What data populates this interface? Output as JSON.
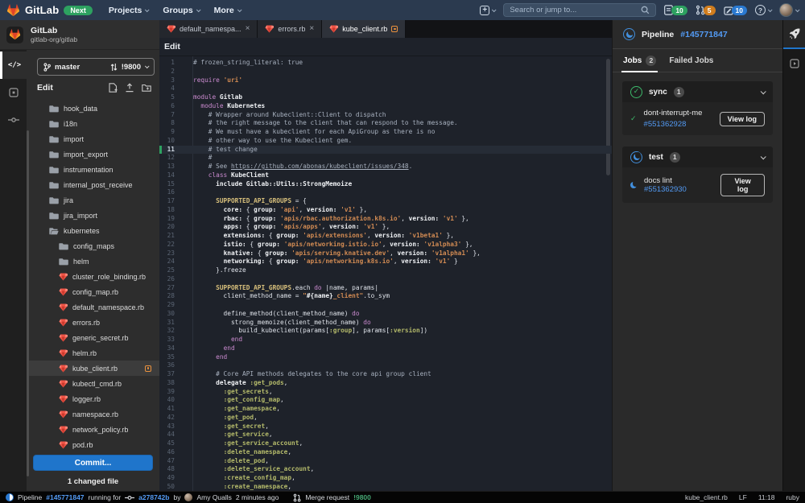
{
  "topbar": {
    "product_name": "GitLab",
    "next_badge": "Next",
    "nav": [
      {
        "label": "Projects"
      },
      {
        "label": "Groups"
      },
      {
        "label": "More"
      }
    ],
    "search_placeholder": "Search or jump to...",
    "issues_count": "10",
    "merge_requests_count": "5",
    "todos_count": "10"
  },
  "project": {
    "name": "GitLab",
    "path": "gitlab-org/gitlab"
  },
  "sidebar": {
    "branch": "master",
    "merge_request_ref": "!9800",
    "panel_title": "Edit",
    "tree": [
      {
        "type": "folder",
        "name": "hook_data",
        "indent": 0
      },
      {
        "type": "folder",
        "name": "i18n",
        "indent": 0
      },
      {
        "type": "folder",
        "name": "import",
        "indent": 0
      },
      {
        "type": "folder",
        "name": "import_export",
        "indent": 0
      },
      {
        "type": "folder",
        "name": "instrumentation",
        "indent": 0
      },
      {
        "type": "folder",
        "name": "internal_post_receive",
        "indent": 0
      },
      {
        "type": "folder",
        "name": "jira",
        "indent": 0
      },
      {
        "type": "folder",
        "name": "jira_import",
        "indent": 0
      },
      {
        "type": "folder-open",
        "name": "kubernetes",
        "indent": 0
      },
      {
        "type": "folder",
        "name": "config_maps",
        "indent": 1
      },
      {
        "type": "folder",
        "name": "helm",
        "indent": 1
      },
      {
        "type": "file",
        "name": "cluster_role_binding.rb",
        "indent": 1
      },
      {
        "type": "file",
        "name": "config_map.rb",
        "indent": 1
      },
      {
        "type": "file",
        "name": "default_namespace.rb",
        "indent": 1
      },
      {
        "type": "file",
        "name": "errors.rb",
        "indent": 1
      },
      {
        "type": "file",
        "name": "generic_secret.rb",
        "indent": 1
      },
      {
        "type": "file",
        "name": "helm.rb",
        "indent": 1
      },
      {
        "type": "file",
        "name": "kube_client.rb",
        "indent": 1,
        "selected": true,
        "modified": true
      },
      {
        "type": "file",
        "name": "kubectl_cmd.rb",
        "indent": 1
      },
      {
        "type": "file",
        "name": "logger.rb",
        "indent": 1
      },
      {
        "type": "file",
        "name": "namespace.rb",
        "indent": 1
      },
      {
        "type": "file",
        "name": "network_policy.rb",
        "indent": 1
      },
      {
        "type": "file",
        "name": "pod.rb",
        "indent": 1
      }
    ],
    "commit_button": "Commit...",
    "changed_files": "1 changed file"
  },
  "editor": {
    "mode_label": "Edit",
    "tabs": [
      {
        "label": "default_namespa...",
        "closable": true
      },
      {
        "label": "errors.rb",
        "closable": true
      },
      {
        "label": "kube_client.rb",
        "active": true,
        "modified": true
      }
    ],
    "current_line": 11,
    "lines": [
      [
        [
          "c",
          "# frozen_string_literal: true"
        ]
      ],
      [],
      [
        [
          "k",
          "require"
        ],
        [
          "p",
          " "
        ],
        [
          "s",
          "'uri'"
        ]
      ],
      [],
      [
        [
          "k",
          "module"
        ],
        [
          "p",
          " "
        ],
        [
          "b",
          "Gitlab"
        ]
      ],
      [
        [
          "p",
          "  "
        ],
        [
          "k",
          "module"
        ],
        [
          "p",
          " "
        ],
        [
          "b",
          "Kubernetes"
        ]
      ],
      [
        [
          "p",
          "    "
        ],
        [
          "c",
          "# Wrapper around Kubeclient::Client to dispatch"
        ]
      ],
      [
        [
          "p",
          "    "
        ],
        [
          "c",
          "# the right message to the client that can respond to the message."
        ]
      ],
      [
        [
          "p",
          "    "
        ],
        [
          "c",
          "# We must have a kubeclient for each ApiGroup as there is no"
        ]
      ],
      [
        [
          "p",
          "    "
        ],
        [
          "c",
          "# other way to use the Kubeclient gem."
        ]
      ],
      [
        [
          "p",
          "    "
        ],
        [
          "c",
          "# test change"
        ]
      ],
      [
        [
          "p",
          "    "
        ],
        [
          "c",
          "#"
        ]
      ],
      [
        [
          "p",
          "    "
        ],
        [
          "c",
          "# See "
        ],
        [
          "u",
          "https://github.com/abonas/kubeclient/issues/348"
        ],
        [
          "c",
          "."
        ]
      ],
      [
        [
          "p",
          "    "
        ],
        [
          "k",
          "class"
        ],
        [
          "p",
          " "
        ],
        [
          "b",
          "KubeClient"
        ]
      ],
      [
        [
          "p",
          "      "
        ],
        [
          "b",
          "include Gitlab::Utils::StrongMemoize"
        ]
      ],
      [],
      [
        [
          "p",
          "      "
        ],
        [
          "y",
          "SUPPORTED_API_GROUPS"
        ],
        [
          "p",
          " = {"
        ]
      ],
      [
        [
          "p",
          "        "
        ],
        [
          "b",
          "core:"
        ],
        [
          "p",
          " { "
        ],
        [
          "b",
          "group:"
        ],
        [
          "p",
          " "
        ],
        [
          "s",
          "'api'"
        ],
        [
          "p",
          ", "
        ],
        [
          "b",
          "version:"
        ],
        [
          "p",
          " "
        ],
        [
          "s",
          "'v1'"
        ],
        [
          "p",
          " },"
        ]
      ],
      [
        [
          "p",
          "        "
        ],
        [
          "b",
          "rbac:"
        ],
        [
          "p",
          " { "
        ],
        [
          "b",
          "group:"
        ],
        [
          "p",
          " "
        ],
        [
          "s",
          "'apis/rbac.authorization.k8s.io'"
        ],
        [
          "p",
          ", "
        ],
        [
          "b",
          "version:"
        ],
        [
          "p",
          " "
        ],
        [
          "s",
          "'v1'"
        ],
        [
          "p",
          " },"
        ]
      ],
      [
        [
          "p",
          "        "
        ],
        [
          "b",
          "apps:"
        ],
        [
          "p",
          " { "
        ],
        [
          "b",
          "group:"
        ],
        [
          "p",
          " "
        ],
        [
          "s",
          "'apis/apps'"
        ],
        [
          "p",
          ", "
        ],
        [
          "b",
          "version:"
        ],
        [
          "p",
          " "
        ],
        [
          "s",
          "'v1'"
        ],
        [
          "p",
          " },"
        ]
      ],
      [
        [
          "p",
          "        "
        ],
        [
          "b",
          "extensions:"
        ],
        [
          "p",
          " { "
        ],
        [
          "b",
          "group:"
        ],
        [
          "p",
          " "
        ],
        [
          "s",
          "'apis/extensions'"
        ],
        [
          "p",
          ", "
        ],
        [
          "b",
          "version:"
        ],
        [
          "p",
          " "
        ],
        [
          "s",
          "'v1beta1'"
        ],
        [
          "p",
          " },"
        ]
      ],
      [
        [
          "p",
          "        "
        ],
        [
          "b",
          "istio:"
        ],
        [
          "p",
          " { "
        ],
        [
          "b",
          "group:"
        ],
        [
          "p",
          " "
        ],
        [
          "s",
          "'apis/networking.istio.io'"
        ],
        [
          "p",
          ", "
        ],
        [
          "b",
          "version:"
        ],
        [
          "p",
          " "
        ],
        [
          "s",
          "'v1alpha3'"
        ],
        [
          "p",
          " },"
        ]
      ],
      [
        [
          "p",
          "        "
        ],
        [
          "b",
          "knative:"
        ],
        [
          "p",
          " { "
        ],
        [
          "b",
          "group:"
        ],
        [
          "p",
          " "
        ],
        [
          "s",
          "'apis/serving.knative.dev'"
        ],
        [
          "p",
          ", "
        ],
        [
          "b",
          "version:"
        ],
        [
          "p",
          " "
        ],
        [
          "s",
          "'v1alpha1'"
        ],
        [
          "p",
          " },"
        ]
      ],
      [
        [
          "p",
          "        "
        ],
        [
          "b",
          "networking:"
        ],
        [
          "p",
          " { "
        ],
        [
          "b",
          "group:"
        ],
        [
          "p",
          " "
        ],
        [
          "s",
          "'apis/networking.k8s.io'"
        ],
        [
          "p",
          ", "
        ],
        [
          "b",
          "version:"
        ],
        [
          "p",
          " "
        ],
        [
          "s",
          "'v1'"
        ],
        [
          "p",
          " }"
        ]
      ],
      [
        [
          "p",
          "      }.freeze"
        ]
      ],
      [],
      [
        [
          "p",
          "      "
        ],
        [
          "y",
          "SUPPORTED_API_GROUPS"
        ],
        [
          "p",
          ".each "
        ],
        [
          "k",
          "do"
        ],
        [
          "p",
          " |name, params|"
        ]
      ],
      [
        [
          "p",
          "        client_method_name = "
        ],
        [
          "s",
          "\""
        ],
        [
          "b",
          "#{name}"
        ],
        [
          "s",
          "_client\""
        ],
        [
          "p",
          ".to_sym"
        ]
      ],
      [],
      [
        [
          "p",
          "        define_method(client_method_name) "
        ],
        [
          "k",
          "do"
        ]
      ],
      [
        [
          "p",
          "          strong_memoize(client_method_name) "
        ],
        [
          "k",
          "do"
        ]
      ],
      [
        [
          "p",
          "            build_kubeclient(params["
        ],
        [
          "m",
          ":group"
        ],
        [
          "p",
          "], params["
        ],
        [
          "m",
          ":version"
        ],
        [
          "p",
          "])"
        ]
      ],
      [
        [
          "p",
          "          "
        ],
        [
          "k",
          "end"
        ]
      ],
      [
        [
          "p",
          "        "
        ],
        [
          "k",
          "end"
        ]
      ],
      [
        [
          "p",
          "      "
        ],
        [
          "k",
          "end"
        ]
      ],
      [],
      [
        [
          "p",
          "      "
        ],
        [
          "c",
          "# Core API methods delegates to the core api group client"
        ]
      ],
      [
        [
          "p",
          "      "
        ],
        [
          "b",
          "delegate "
        ],
        [
          "m",
          ":get_pods"
        ],
        [
          "p",
          ","
        ]
      ],
      [
        [
          "p",
          "        "
        ],
        [
          "m",
          ":get_secrets"
        ],
        [
          "p",
          ","
        ]
      ],
      [
        [
          "p",
          "        "
        ],
        [
          "m",
          ":get_config_map"
        ],
        [
          "p",
          ","
        ]
      ],
      [
        [
          "p",
          "        "
        ],
        [
          "m",
          ":get_namespace"
        ],
        [
          "p",
          ","
        ]
      ],
      [
        [
          "p",
          "        "
        ],
        [
          "m",
          ":get_pod"
        ],
        [
          "p",
          ","
        ]
      ],
      [
        [
          "p",
          "        "
        ],
        [
          "m",
          ":get_secret"
        ],
        [
          "p",
          ","
        ]
      ],
      [
        [
          "p",
          "        "
        ],
        [
          "m",
          ":get_service"
        ],
        [
          "p",
          ","
        ]
      ],
      [
        [
          "p",
          "        "
        ],
        [
          "m",
          ":get_service_account"
        ],
        [
          "p",
          ","
        ]
      ],
      [
        [
          "p",
          "        "
        ],
        [
          "m",
          ":delete_namespace"
        ],
        [
          "p",
          ","
        ]
      ],
      [
        [
          "p",
          "        "
        ],
        [
          "m",
          ":delete_pod"
        ],
        [
          "p",
          ","
        ]
      ],
      [
        [
          "p",
          "        "
        ],
        [
          "m",
          ":delete_service_account"
        ],
        [
          "p",
          ","
        ]
      ],
      [
        [
          "p",
          "        "
        ],
        [
          "m",
          ":create_config_map"
        ],
        [
          "p",
          ","
        ]
      ],
      [
        [
          "p",
          "        "
        ],
        [
          "m",
          ":create_namespace"
        ],
        [
          "p",
          ","
        ]
      ]
    ]
  },
  "right_panel": {
    "pipeline_label": "Pipeline",
    "pipeline_id": "#145771847",
    "tabs": [
      {
        "label": "Jobs",
        "count": "2",
        "active": true
      },
      {
        "label": "Failed Jobs"
      }
    ],
    "groups": [
      {
        "name": "sync",
        "count": "1",
        "status": "success",
        "jobs": [
          {
            "name": "dont-interrupt-me",
            "id": "#551362928",
            "status": "success",
            "action": "View log",
            "stacked": true
          }
        ]
      },
      {
        "name": "test",
        "count": "1",
        "status": "running",
        "jobs": [
          {
            "name": "docs lint",
            "id": "#551362930",
            "status": "running",
            "action": "View log"
          }
        ]
      }
    ]
  },
  "statusbar": {
    "pipeline_label": "Pipeline",
    "pipeline_id": "#145771847",
    "running_for_label": "running for",
    "commit_sha": "a278742b",
    "by_label": "by",
    "author": "Amy Qualls",
    "time_ago": "2 minutes ago",
    "mr_label": "Merge request",
    "mr_id": "!9800",
    "file_name": "kube_client.rb",
    "line_ending": "LF",
    "cursor_position": "11:18",
    "language": "ruby"
  },
  "icons": {
    "close": "×",
    "check": "✓",
    "question": "?",
    "plus": "+"
  },
  "colors": {
    "link_blue": "#539bf5",
    "commit_blue": "#1f75cb",
    "success_green": "#3dba6b",
    "running_blue": "#428fdc",
    "modified_orange": "#e9913e",
    "navbar": "#2b3a4f"
  }
}
